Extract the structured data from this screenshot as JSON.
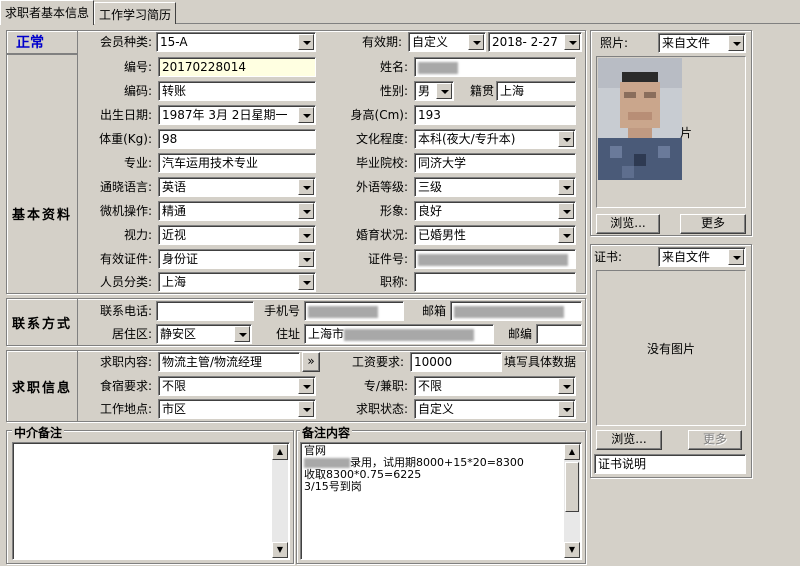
{
  "tabs": [
    {
      "label": "求职者基本信息"
    },
    {
      "label": "工作学习简历"
    }
  ],
  "status": {
    "label": "正常",
    "color": "#0000cc"
  },
  "member_type": {
    "label": "会员种类:",
    "value": "15-A"
  },
  "validity": {
    "label": "有效期:",
    "mode": "自定义",
    "date": "2018- 2-27"
  },
  "photo": {
    "label": "照片:",
    "source": "来自文件",
    "overlay_text": "片",
    "browse_label": "浏览...",
    "more_label": "更多"
  },
  "certificate": {
    "label": "证书:",
    "source": "来自文件",
    "empty_text": "没有图片",
    "browse_label": "浏览...",
    "more_label": "更多",
    "desc_label": "证书说明"
  },
  "sections": {
    "basic": "基本资料",
    "contact": "联系方式",
    "job": "求职信息"
  },
  "basic": {
    "id_label": "编号:",
    "id_value": "20170228014",
    "name_label": "姓名:",
    "code_label": "编码:",
    "code_value": "转账",
    "gender_label": "性别:",
    "gender_value": "男",
    "native_label": "籍贯",
    "native_value": "上海",
    "birth_label": "出生日期:",
    "birth_value": "1987年 3月 2日星期一",
    "height_label": "身高(Cm):",
    "height_value": "193",
    "weight_label": "体重(Kg):",
    "weight_value": "98",
    "edu_label": "文化程度:",
    "edu_value": "本科(夜大/专升本)",
    "major_label": "专业:",
    "major_value": "汽车运用技术专业",
    "school_label": "毕业院校:",
    "school_value": "同济大学",
    "lang_label": "通晓语言:",
    "lang_value": "英语",
    "lang_level_label": "外语等级:",
    "lang_level_value": "三级",
    "pc_label": "微机操作:",
    "pc_value": "精通",
    "image_label": "形象:",
    "image_value": "良好",
    "vision_label": "视力:",
    "vision_value": "近视",
    "marriage_label": "婚育状况:",
    "marriage_value": "已婚男性",
    "idtype_label": "有效证件:",
    "idtype_value": "身份证",
    "idno_label": "证件号:",
    "category_label": "人员分类:",
    "category_value": "上海",
    "title_label": "职称:"
  },
  "contact": {
    "phone_label": "联系电话:",
    "mobile_label": "手机号",
    "email_label": "邮箱",
    "district_label": "居住区:",
    "district_value": "静安区",
    "address_label": "住址",
    "address_prefix": "上海市",
    "zip_label": "邮编"
  },
  "job": {
    "content_label": "求职内容:",
    "content_value": "物流主管/物流经理",
    "more_btn": "»",
    "salary_label": "工资要求:",
    "salary_value": "10000",
    "salary_note": "填写具体数据",
    "board_label": "食宿要求:",
    "board_value": "不限",
    "parttime_label": "专/兼职:",
    "parttime_value": "不限",
    "location_label": "工作地点:",
    "location_value": "市区",
    "state_label": "求职状态:",
    "state_value": "自定义"
  },
  "agent_note": {
    "title": "中介备注"
  },
  "remark": {
    "title": "备注内容",
    "lines": [
      "官网",
      "录用，试用期8000+15*20=8300",
      "收取8300*0.75=6225",
      "3/15号到岗"
    ]
  },
  "icons": {
    "scroll_up": "▲",
    "scroll_down": "▼"
  }
}
